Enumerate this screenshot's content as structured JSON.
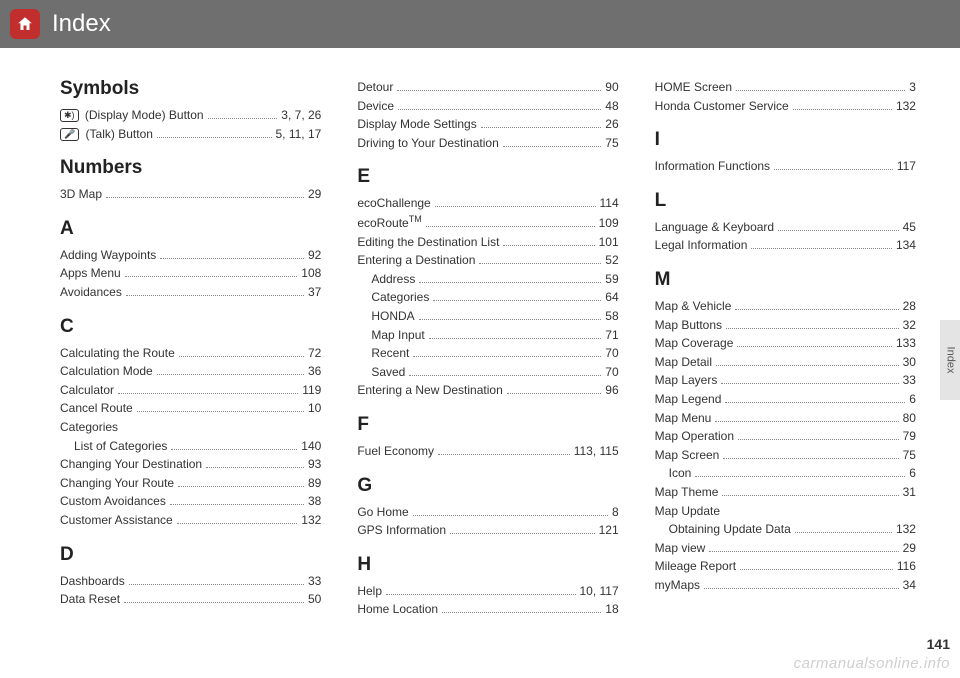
{
  "header": {
    "title": "Index"
  },
  "side_tab": {
    "label": "Index"
  },
  "page_number": "141",
  "watermark": "carmanualsonline.info",
  "columns": [
    {
      "groups": [
        {
          "heading": "Symbols",
          "entries": [
            {
              "icon": "✱)",
              "label": "(Display Mode) Button",
              "page": "3, 7, 26"
            },
            {
              "icon": "🎤",
              "label": "(Talk) Button",
              "page": "5, 11, 17"
            }
          ]
        },
        {
          "heading": "Numbers",
          "entries": [
            {
              "label": "3D Map",
              "page": "29"
            }
          ]
        },
        {
          "heading": "A",
          "entries": [
            {
              "label": "Adding Waypoints",
              "page": "92"
            },
            {
              "label": "Apps Menu",
              "page": "108"
            },
            {
              "label": "Avoidances",
              "page": "37"
            }
          ]
        },
        {
          "heading": "C",
          "entries": [
            {
              "label": "Calculating the Route",
              "page": "72"
            },
            {
              "label": "Calculation Mode",
              "page": "36"
            },
            {
              "label": "Calculator",
              "page": "119"
            },
            {
              "label": "Cancel Route",
              "page": "10"
            },
            {
              "label": "Categories",
              "page": ""
            },
            {
              "label": "List of Categories",
              "page": "140",
              "sub": true
            },
            {
              "label": "Changing Your Destination",
              "page": "93"
            },
            {
              "label": "Changing Your Route",
              "page": "89"
            },
            {
              "label": "Custom Avoidances",
              "page": "38"
            },
            {
              "label": "Customer Assistance",
              "page": "132"
            }
          ]
        },
        {
          "heading": "D",
          "entries": [
            {
              "label": "Dashboards",
              "page": "33"
            },
            {
              "label": "Data Reset",
              "page": "50"
            }
          ]
        }
      ]
    },
    {
      "groups": [
        {
          "heading": "",
          "entries": [
            {
              "label": "Detour",
              "page": "90"
            },
            {
              "label": "Device",
              "page": "48"
            },
            {
              "label": "Display Mode Settings",
              "page": "26"
            },
            {
              "label": "Driving to Your Destination",
              "page": "75"
            }
          ]
        },
        {
          "heading": "E",
          "entries": [
            {
              "label": "ecoChallenge",
              "page": "114"
            },
            {
              "label": "ecoRoute",
              "suffix": "TM",
              "page": "109"
            },
            {
              "label": "Editing the Destination List",
              "page": "101"
            },
            {
              "label": "Entering a Destination",
              "page": "52"
            },
            {
              "label": "Address",
              "page": "59",
              "sub": true
            },
            {
              "label": "Categories",
              "page": "64",
              "sub": true
            },
            {
              "label": "HONDA",
              "page": "58",
              "sub": true
            },
            {
              "label": "Map Input",
              "page": "71",
              "sub": true
            },
            {
              "label": "Recent",
              "page": "70",
              "sub": true
            },
            {
              "label": "Saved",
              "page": "70",
              "sub": true
            },
            {
              "label": "Entering a New Destination",
              "page": "96"
            }
          ]
        },
        {
          "heading": "F",
          "entries": [
            {
              "label": "Fuel Economy",
              "page": "113, 115"
            }
          ]
        },
        {
          "heading": "G",
          "entries": [
            {
              "label": "Go Home",
              "page": "8"
            },
            {
              "label": "GPS Information",
              "page": "121"
            }
          ]
        },
        {
          "heading": "H",
          "entries": [
            {
              "label": "Help",
              "page": "10, 117"
            },
            {
              "label": "Home Location",
              "page": "18"
            }
          ]
        }
      ]
    },
    {
      "groups": [
        {
          "heading": "",
          "entries": [
            {
              "label": "HOME Screen",
              "page": "3"
            },
            {
              "label": "Honda Customer Service",
              "page": "132"
            }
          ]
        },
        {
          "heading": "I",
          "entries": [
            {
              "label": "Information Functions",
              "page": "117"
            }
          ]
        },
        {
          "heading": "L",
          "entries": [
            {
              "label": "Language & Keyboard",
              "page": "45"
            },
            {
              "label": "Legal Information",
              "page": "134"
            }
          ]
        },
        {
          "heading": "M",
          "entries": [
            {
              "label": "Map & Vehicle",
              "page": "28"
            },
            {
              "label": "Map Buttons",
              "page": "32"
            },
            {
              "label": "Map Coverage",
              "page": "133"
            },
            {
              "label": "Map Detail",
              "page": "30"
            },
            {
              "label": "Map Layers",
              "page": "33"
            },
            {
              "label": "Map Legend",
              "page": "6"
            },
            {
              "label": "Map Menu",
              "page": "80"
            },
            {
              "label": "Map Operation",
              "page": "79"
            },
            {
              "label": "Map Screen",
              "page": "75"
            },
            {
              "label": "Icon",
              "page": "6",
              "sub": true
            },
            {
              "label": "Map Theme",
              "page": "31"
            },
            {
              "label": "Map Update",
              "page": ""
            },
            {
              "label": "Obtaining Update Data",
              "page": "132",
              "sub": true
            },
            {
              "label": "Map view",
              "page": "29"
            },
            {
              "label": "Mileage Report",
              "page": "116"
            },
            {
              "label": "myMaps",
              "page": "34"
            }
          ]
        }
      ]
    }
  ]
}
